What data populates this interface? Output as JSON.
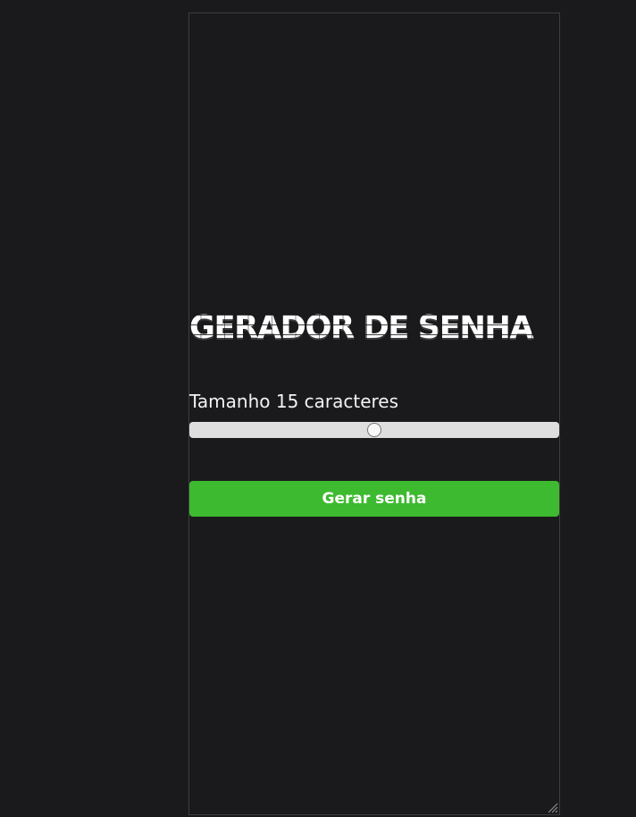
{
  "app": {
    "title": "GERADOR DE SENHA",
    "length_label": "Tamanho 15 caracteres",
    "slider": {
      "value": 15,
      "position_fraction": 0.5
    },
    "generate_button": "Gerar senha"
  },
  "colors": {
    "background": "#1a1a1c",
    "button": "#3dba2f",
    "track": "#dedede",
    "text": "#ffffff"
  },
  "icons": {
    "resize_grip": "resize-grip-icon"
  }
}
